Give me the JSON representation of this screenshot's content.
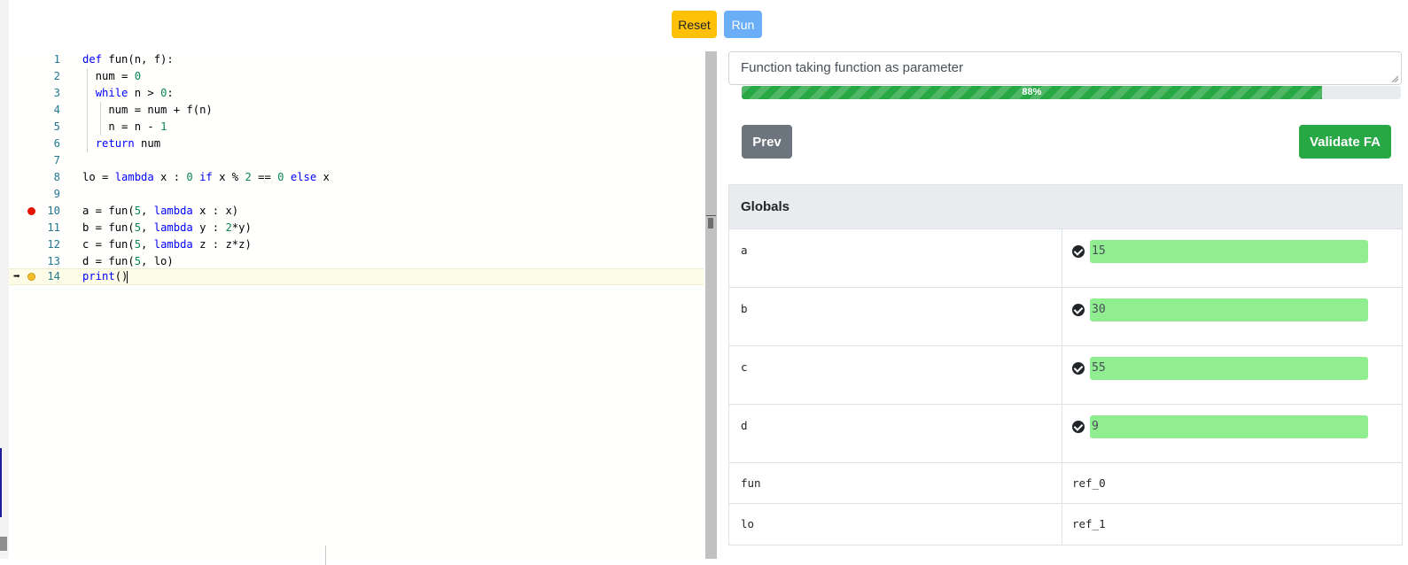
{
  "toolbar": {
    "reset_label": "Reset",
    "run_label": "Run"
  },
  "editor": {
    "lines": [
      {
        "n": "1"
      },
      {
        "n": "2"
      },
      {
        "n": "3"
      },
      {
        "n": "4"
      },
      {
        "n": "5"
      },
      {
        "n": "6"
      },
      {
        "n": "7"
      },
      {
        "n": "8"
      },
      {
        "n": "9"
      },
      {
        "n": "10"
      },
      {
        "n": "11"
      },
      {
        "n": "12"
      },
      {
        "n": "13"
      },
      {
        "n": "14"
      }
    ],
    "code": {
      "l1_a": "def",
      "l1_b": " fun(n, f):",
      "l2_a": "  num = ",
      "l2_b": "0",
      "l3_a": "  ",
      "l3_b": "while",
      "l3_c": " n > ",
      "l3_d": "0",
      "l3_e": ":",
      "l4": "    num = num + f(n)",
      "l5_a": "    n = n - ",
      "l5_b": "1",
      "l6_a": "  ",
      "l6_b": "return",
      "l6_c": " num",
      "l8_a": "lo = ",
      "l8_b": "lambda",
      "l8_c": " x : ",
      "l8_d": "0",
      "l8_e": " ",
      "l8_f": "if",
      "l8_g": " x % ",
      "l8_h": "2",
      "l8_i": " == ",
      "l8_j": "0",
      "l8_k": " ",
      "l8_l": "else",
      "l8_m": " x",
      "l10_a": "a = fun(",
      "l10_b": "5",
      "l10_c": ", ",
      "l10_d": "lambda",
      "l10_e": " x : x)",
      "l11_a": "b = fun(",
      "l11_b": "5",
      "l11_c": ", ",
      "l11_d": "lambda",
      "l11_e": " y : ",
      "l11_f": "2",
      "l11_g": "*y)",
      "l12_a": "c = fun(",
      "l12_b": "5",
      "l12_c": ", ",
      "l12_d": "lambda",
      "l12_e": " z : z*z)",
      "l13_a": "d = fun(",
      "l13_b": "5",
      "l13_c": ", lo)",
      "l14_a": "print",
      "l14_b": "()"
    },
    "breakpoint_line": "10",
    "current_line": "14"
  },
  "exercise": {
    "title": "Function taking function as parameter",
    "progress": 88,
    "progress_label": "88%",
    "prev_label": "Prev",
    "validate_label": "Validate FA"
  },
  "globals": {
    "header": "Globals",
    "rows": [
      {
        "name": "a",
        "value": "15",
        "status": "correct"
      },
      {
        "name": "b",
        "value": "30",
        "status": "correct"
      },
      {
        "name": "c",
        "value": "55",
        "status": "correct"
      },
      {
        "name": "d",
        "value": "9",
        "status": "correct"
      },
      {
        "name": "fun",
        "value": "ref_0"
      },
      {
        "name": "lo",
        "value": "ref_1"
      }
    ]
  },
  "colors": {
    "reset": "#ffc107",
    "run": "#6aaef7",
    "progress": "#28a745",
    "validate": "#28a745",
    "prev": "#6c757d",
    "correct_value_bg": "#90ee90",
    "keyword": "#0000ff",
    "number": "#098658",
    "breakpoint": "#e51400"
  }
}
